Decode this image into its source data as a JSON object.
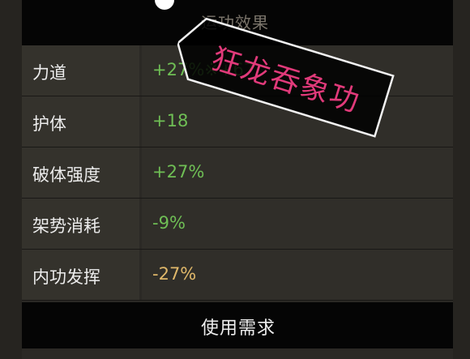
{
  "header": {
    "title": "运功效果"
  },
  "tag": {
    "label": "狂龙吞象功",
    "color": "#e13a7a",
    "background": "#f2f2f2"
  },
  "rows": [
    {
      "label": "力道",
      "value": "+27%※+67",
      "value_color": "#6fbf55"
    },
    {
      "label": "护体",
      "value": "+18",
      "value_color": "#6fbf55"
    },
    {
      "label": "破体强度",
      "value": "+27%",
      "value_color": "#6fbf55"
    },
    {
      "label": "架势消耗",
      "value": "-9%",
      "value_color": "#6fbf55"
    },
    {
      "label": "内功发挥",
      "value": "-27%",
      "value_color": "#e0b86a"
    }
  ],
  "footer": {
    "title": "使用需求"
  }
}
